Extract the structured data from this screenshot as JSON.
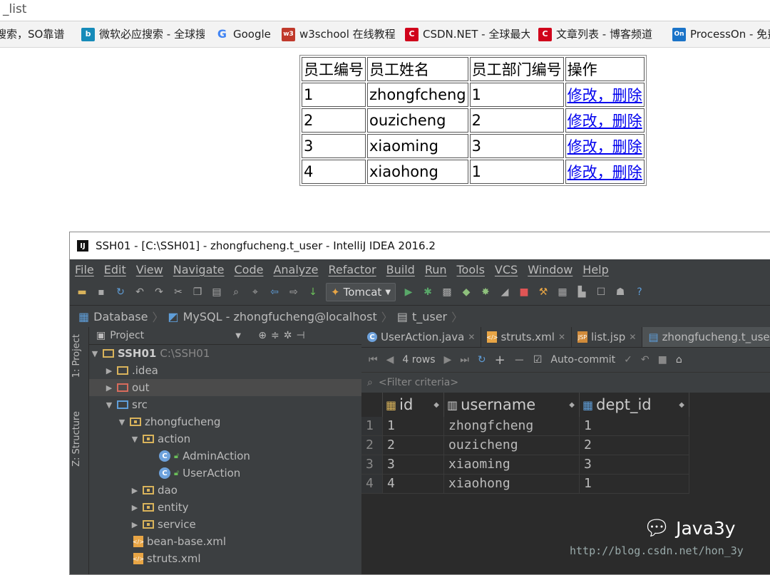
{
  "browser": {
    "tab_title": "_list",
    "bookmarks": [
      {
        "label": "搜索，SO靠谱",
        "icon": "so-search-icon",
        "color": "#f0f0f0"
      },
      {
        "label": "微软必应搜索 - 全球搜",
        "icon": "bing-icon",
        "color": "#168bb9"
      },
      {
        "label": "Google",
        "icon": "google-icon",
        "color": "#4285f4"
      },
      {
        "label": "w3school 在线教程",
        "icon": "w3school-icon",
        "color": "#c0392b"
      },
      {
        "label": "CSDN.NET - 全球最大",
        "icon": "csdn-icon",
        "color": "#d0021b"
      },
      {
        "label": "文章列表 - 博客频道",
        "icon": "csdn-blog-icon",
        "color": "#d0021b"
      },
      {
        "label": "ProcessOn - 免费",
        "icon": "processon-icon",
        "color": "#1a73c8"
      }
    ]
  },
  "employee_table": {
    "headers": [
      "员工编号",
      "员工姓名",
      "员工部门编号",
      "操作"
    ],
    "rows": [
      {
        "id": "1",
        "name": "zhongfcheng",
        "dept": "1",
        "action": "修改，删除"
      },
      {
        "id": "2",
        "name": "ouzicheng",
        "dept": "2",
        "action": "修改，删除"
      },
      {
        "id": "3",
        "name": "xiaoming",
        "dept": "3",
        "action": "修改，删除"
      },
      {
        "id": "4",
        "name": "xiaohong",
        "dept": "1",
        "action": "修改，删除"
      }
    ]
  },
  "ide": {
    "title": "SSH01 - [C:\\SSH01] - zhongfucheng.t_user - IntelliJ IDEA 2016.2",
    "logo_text": "IJ",
    "menu": [
      "File",
      "Edit",
      "View",
      "Navigate",
      "Code",
      "Analyze",
      "Refactor",
      "Build",
      "Run",
      "Tools",
      "VCS",
      "Window",
      "Help"
    ],
    "run_config": "Tomcat",
    "breadcrumbs": [
      "Database",
      "MySQL - zhongfucheng@localhost",
      "t_user"
    ],
    "side_tabs": [
      "1: Project",
      "Z: Structure"
    ],
    "project_panel": {
      "title": "Project",
      "tree": [
        {
          "label": "SSH01",
          "extra": "C:\\SSH01",
          "depth": 0,
          "arrow": "▼",
          "type": "module"
        },
        {
          "label": ".idea",
          "depth": 1,
          "arrow": "▶",
          "type": "folder"
        },
        {
          "label": "out",
          "depth": 1,
          "arrow": "▶",
          "type": "folder-red"
        },
        {
          "label": "src",
          "depth": 1,
          "arrow": "▼",
          "type": "folder-blue"
        },
        {
          "label": "zhongfucheng",
          "depth": 2,
          "arrow": "▼",
          "type": "package"
        },
        {
          "label": "action",
          "depth": 3,
          "arrow": "▼",
          "type": "package"
        },
        {
          "label": "AdminAction",
          "depth": 4,
          "arrow": "",
          "type": "class"
        },
        {
          "label": "UserAction",
          "depth": 4,
          "arrow": "",
          "type": "class"
        },
        {
          "label": "dao",
          "depth": 3,
          "arrow": "▶",
          "type": "package"
        },
        {
          "label": "entity",
          "depth": 3,
          "arrow": "▶",
          "type": "package"
        },
        {
          "label": "service",
          "depth": 3,
          "arrow": "▶",
          "type": "package"
        },
        {
          "label": "bean-base.xml",
          "depth": 2,
          "arrow": "",
          "type": "xml"
        },
        {
          "label": "struts.xml",
          "depth": 2,
          "arrow": "",
          "type": "xml"
        }
      ]
    },
    "editor_tabs": [
      "UserAction.java",
      "struts.xml",
      "list.jsp",
      "zhongfucheng.t_user"
    ],
    "db_toolbar": {
      "rows_label": "4 rows",
      "autocommit_label": "Auto-commit"
    },
    "filter_placeholder": "<Filter criteria>",
    "grid": {
      "columns": [
        "id",
        "username",
        "dept_id"
      ],
      "rows": [
        {
          "n": "1",
          "id": "1",
          "username": "zhongfcheng",
          "dept_id": "1"
        },
        {
          "n": "2",
          "id": "2",
          "username": "ouzicheng",
          "dept_id": "2"
        },
        {
          "n": "3",
          "id": "3",
          "username": "xiaoming",
          "dept_id": "3"
        },
        {
          "n": "4",
          "id": "4",
          "username": "xiaohong",
          "dept_id": "1"
        }
      ]
    }
  },
  "watermark": {
    "brand": "Java3y",
    "url": "http://blog.csdn.net/hon_3y"
  }
}
